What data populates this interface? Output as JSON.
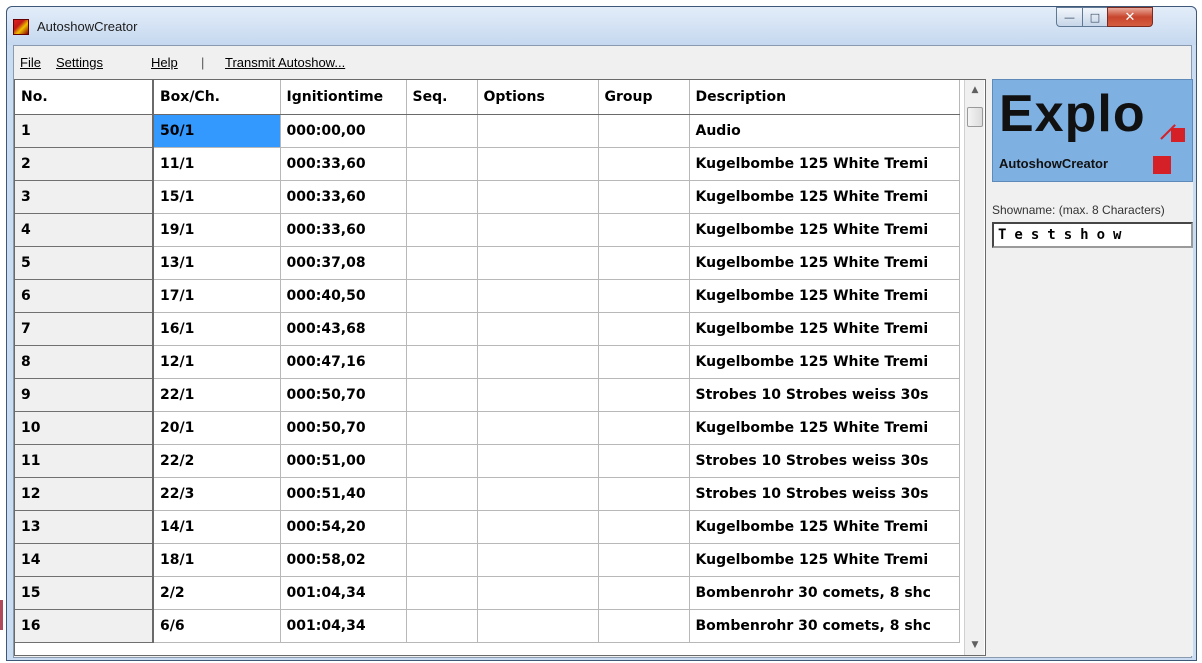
{
  "window": {
    "title": "AutoshowCreator"
  },
  "menu": {
    "file": "File",
    "settings": "Settings",
    "help": "Help",
    "separator": "|",
    "transmit": "Transmit Autoshow..."
  },
  "grid": {
    "columns": [
      "No.",
      "Box/Ch.",
      "Ignitiontime",
      "Seq.",
      "Options",
      "Group",
      "Description"
    ],
    "rows": [
      {
        "no": "1",
        "box": "50/1",
        "time": "000:00,00",
        "seq": "",
        "options": "",
        "group": "",
        "desc": "Audio"
      },
      {
        "no": "2",
        "box": "11/1",
        "time": "000:33,60",
        "seq": "",
        "options": "",
        "group": "",
        "desc": "Kugelbombe 125 White Tremi"
      },
      {
        "no": "3",
        "box": "15/1",
        "time": "000:33,60",
        "seq": "",
        "options": "",
        "group": "",
        "desc": "Kugelbombe 125 White Tremi"
      },
      {
        "no": "4",
        "box": "19/1",
        "time": "000:33,60",
        "seq": "",
        "options": "",
        "group": "",
        "desc": "Kugelbombe 125 White Tremi"
      },
      {
        "no": "5",
        "box": "13/1",
        "time": "000:37,08",
        "seq": "",
        "options": "",
        "group": "",
        "desc": "Kugelbombe 125 White Tremi"
      },
      {
        "no": "6",
        "box": "17/1",
        "time": "000:40,50",
        "seq": "",
        "options": "",
        "group": "",
        "desc": "Kugelbombe 125 White Tremi"
      },
      {
        "no": "7",
        "box": "16/1",
        "time": "000:43,68",
        "seq": "",
        "options": "",
        "group": "",
        "desc": "Kugelbombe 125 White Tremi"
      },
      {
        "no": "8",
        "box": "12/1",
        "time": "000:47,16",
        "seq": "",
        "options": "",
        "group": "",
        "desc": "Kugelbombe 125 White Tremi"
      },
      {
        "no": "9",
        "box": "22/1",
        "time": "000:50,70",
        "seq": "",
        "options": "",
        "group": "",
        "desc": "Strobes 10 Strobes weiss 30s"
      },
      {
        "no": "10",
        "box": "20/1",
        "time": "000:50,70",
        "seq": "",
        "options": "",
        "group": "",
        "desc": "Kugelbombe 125 White Tremi"
      },
      {
        "no": "11",
        "box": "22/2",
        "time": "000:51,00",
        "seq": "",
        "options": "",
        "group": "",
        "desc": "Strobes 10 Strobes weiss 30s"
      },
      {
        "no": "12",
        "box": "22/3",
        "time": "000:51,40",
        "seq": "",
        "options": "",
        "group": "",
        "desc": "Strobes 10 Strobes weiss 30s"
      },
      {
        "no": "13",
        "box": "14/1",
        "time": "000:54,20",
        "seq": "",
        "options": "",
        "group": "",
        "desc": "Kugelbombe 125 White Tremi"
      },
      {
        "no": "14",
        "box": "18/1",
        "time": "000:58,02",
        "seq": "",
        "options": "",
        "group": "",
        "desc": "Kugelbombe 125 White Tremi"
      },
      {
        "no": "15",
        "box": "2/2",
        "time": "001:04,34",
        "seq": "",
        "options": "",
        "group": "",
        "desc": "Bombenrohr 30 comets, 8 shc"
      },
      {
        "no": "16",
        "box": "6/6",
        "time": "001:04,34",
        "seq": "",
        "options": "",
        "group": "",
        "desc": "Bombenrohr 30 comets, 8 shc"
      }
    ]
  },
  "sidepanel": {
    "logo_main": "Explo",
    "logo_sub": "AutoshowCreator",
    "showname_label": "Showname: (max. 8 Characters)",
    "showname_value": "Testshow"
  },
  "colors": {
    "selection": "#3399ff",
    "logo_bg": "#7fb0e2",
    "logo_accent": "#d42026"
  }
}
